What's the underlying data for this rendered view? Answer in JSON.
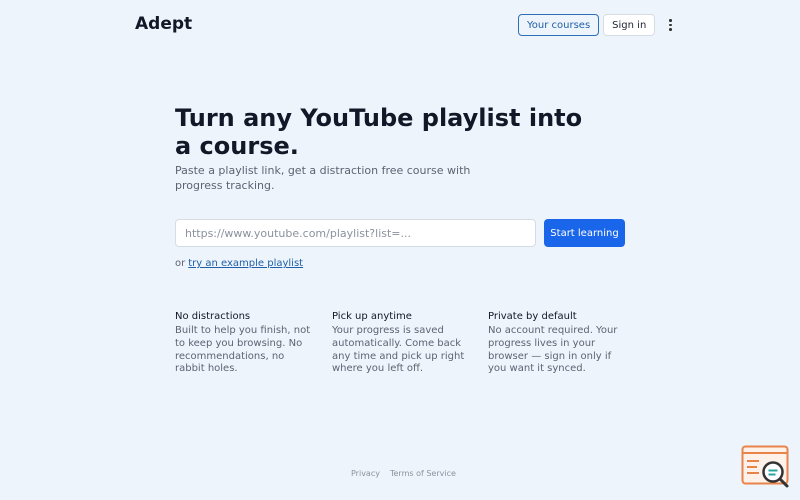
{
  "header": {
    "logo": "Adept",
    "your_courses_label": "Your courses",
    "sign_in_label": "Sign in",
    "more_icon": "vertical-ellipsis-icon"
  },
  "hero": {
    "headline": "Turn any YouTube playlist into a course.",
    "subtitle": "Paste a playlist link, get a distraction free course with progress tracking."
  },
  "form": {
    "placeholder": "https://www.youtube.com/playlist?list=...",
    "value": "",
    "submit_label": "Start learning",
    "or_text": "or",
    "example_link": "try an example playlist"
  },
  "features": [
    {
      "title": "No distractions",
      "text": "Built to help you finish, not to keep you browsing. No recommendations, no rabbit holes."
    },
    {
      "title": "Pick up anytime",
      "text": "Your progress is saved automatically. Come back any time and pick up right where you left off."
    },
    {
      "title": "Private by default",
      "text": "No account required. Your progress lives in your browser — sign in only if you want it synced."
    }
  ],
  "footer": {
    "privacy": "Privacy",
    "terms": "Terms of Service"
  },
  "colors": {
    "background": "#eef4fb",
    "accent": "#1a66ea",
    "link": "#1f5fa8",
    "widget": "#e8834a"
  },
  "widget": {
    "icon": "feedback-search-icon"
  }
}
